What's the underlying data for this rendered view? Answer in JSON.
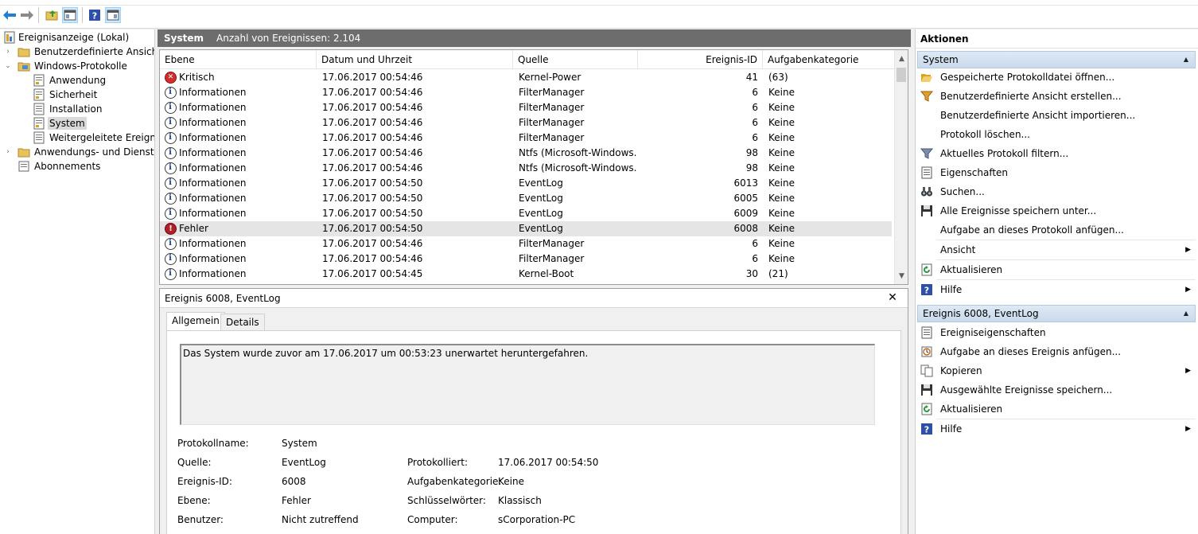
{
  "toolbar": {
    "buttons": [
      "back-icon",
      "forward-icon",
      "up-folder-icon",
      "show-hide-console-tree-icon",
      "help-icon",
      "show-hide-action-pane-icon"
    ]
  },
  "tree": {
    "items": [
      {
        "label": "Ereignisanzeige (Lokal)",
        "icon": "event-viewer-icon"
      },
      {
        "label": "Benutzerdefinierte Ansichten",
        "icon": "folder-icon"
      },
      {
        "label": "Windows-Protokolle",
        "icon": "folder-icon"
      },
      {
        "label": "Anwendung",
        "icon": "log-icon"
      },
      {
        "label": "Sicherheit",
        "icon": "log-icon"
      },
      {
        "label": "Installation",
        "icon": "log-icon"
      },
      {
        "label": "System",
        "icon": "log-icon"
      },
      {
        "label": "Weitergeleitete Ereignisse",
        "icon": "log-icon"
      },
      {
        "label": "Anwendungs- und Dienstprotokolle",
        "icon": "folder-icon"
      },
      {
        "label": "Abonnements",
        "icon": "subscriptions-icon"
      }
    ]
  },
  "center": {
    "title": "System",
    "count_text": "Anzahl von Ereignissen: 2.104"
  },
  "columns": {
    "level": "Ebene",
    "date": "Datum und Uhrzeit",
    "source": "Quelle",
    "id": "Ereignis-ID",
    "category": "Aufgabenkategorie"
  },
  "events": [
    {
      "level": "Kritisch",
      "kind": "crit",
      "date": "17.06.2017 00:54:46",
      "source": "Kernel-Power",
      "id": "41",
      "category": "(63)"
    },
    {
      "level": "Informationen",
      "kind": "info",
      "date": "17.06.2017 00:54:46",
      "source": "FilterManager",
      "id": "6",
      "category": "Keine"
    },
    {
      "level": "Informationen",
      "kind": "info",
      "date": "17.06.2017 00:54:46",
      "source": "FilterManager",
      "id": "6",
      "category": "Keine"
    },
    {
      "level": "Informationen",
      "kind": "info",
      "date": "17.06.2017 00:54:46",
      "source": "FilterManager",
      "id": "6",
      "category": "Keine"
    },
    {
      "level": "Informationen",
      "kind": "info",
      "date": "17.06.2017 00:54:46",
      "source": "FilterManager",
      "id": "6",
      "category": "Keine"
    },
    {
      "level": "Informationen",
      "kind": "info",
      "date": "17.06.2017 00:54:46",
      "source": "Ntfs (Microsoft-Windows...",
      "id": "98",
      "category": "Keine"
    },
    {
      "level": "Informationen",
      "kind": "info",
      "date": "17.06.2017 00:54:46",
      "source": "Ntfs (Microsoft-Windows...",
      "id": "98",
      "category": "Keine"
    },
    {
      "level": "Informationen",
      "kind": "info",
      "date": "17.06.2017 00:54:50",
      "source": "EventLog",
      "id": "6013",
      "category": "Keine"
    },
    {
      "level": "Informationen",
      "kind": "info",
      "date": "17.06.2017 00:54:50",
      "source": "EventLog",
      "id": "6005",
      "category": "Keine"
    },
    {
      "level": "Informationen",
      "kind": "info",
      "date": "17.06.2017 00:54:50",
      "source": "EventLog",
      "id": "6009",
      "category": "Keine"
    },
    {
      "level": "Fehler",
      "kind": "err",
      "date": "17.06.2017 00:54:50",
      "source": "EventLog",
      "id": "6008",
      "category": "Keine",
      "selected": true
    },
    {
      "level": "Informationen",
      "kind": "info",
      "date": "17.06.2017 00:54:46",
      "source": "FilterManager",
      "id": "6",
      "category": "Keine"
    },
    {
      "level": "Informationen",
      "kind": "info",
      "date": "17.06.2017 00:54:46",
      "source": "FilterManager",
      "id": "6",
      "category": "Keine"
    },
    {
      "level": "Informationen",
      "kind": "info",
      "date": "17.06.2017 00:54:45",
      "source": "Kernel-Boot",
      "id": "30",
      "category": "(21)"
    }
  ],
  "detail": {
    "title": "Ereignis 6008, EventLog",
    "tabs": [
      "Allgemein",
      "Details"
    ],
    "message": "Das System wurde zuvor am 17.06.2017 um 00:53:23 unerwartet heruntergefahren.",
    "labels": {
      "logname": "Protokollname:",
      "source": "Quelle:",
      "eventid": "Ereignis-ID:",
      "level": "Ebene:",
      "user": "Benutzer:",
      "logged": "Protokolliert:",
      "taskcat": "Aufgabenkategorie:",
      "keywords": "Schlüsselwörter:",
      "computer": "Computer:"
    },
    "values": {
      "logname": "System",
      "source": "EventLog",
      "eventid": "6008",
      "level": "Fehler",
      "user": "Nicht zutreffend",
      "logged": "17.06.2017 00:54:50",
      "taskcat": "Keine",
      "keywords": "Klassisch",
      "computer": "sCorporation-PC"
    }
  },
  "actions": {
    "title": "Aktionen",
    "section1": "System",
    "items1": [
      {
        "label": "Gespeicherte Protokolldatei öffnen...",
        "icon": "open-folder-icon"
      },
      {
        "label": "Benutzerdefinierte Ansicht erstellen...",
        "icon": "filter-create-icon"
      },
      {
        "label": "Benutzerdefinierte Ansicht importieren...",
        "icon": ""
      },
      {
        "label": "Protokoll löschen...",
        "icon": ""
      },
      {
        "label": "Aktuelles Protokoll filtern...",
        "icon": "filter-icon"
      },
      {
        "label": "Eigenschaften",
        "icon": "properties-icon"
      },
      {
        "label": "Suchen...",
        "icon": "binoculars-icon"
      },
      {
        "label": "Alle Ereignisse speichern unter...",
        "icon": "save-icon"
      },
      {
        "label": "Aufgabe an dieses Protokoll anfügen...",
        "icon": ""
      },
      {
        "label": "Ansicht",
        "icon": "",
        "submenu": true
      },
      {
        "label": "Aktualisieren",
        "icon": "refresh-icon"
      },
      {
        "label": "Hilfe",
        "icon": "help-icon",
        "submenu": true
      }
    ],
    "section2": "Ereignis 6008, EventLog",
    "items2": [
      {
        "label": "Ereigniseigenschaften",
        "icon": "properties-icon"
      },
      {
        "label": "Aufgabe an dieses Ereignis anfügen...",
        "icon": "task-icon"
      },
      {
        "label": "Kopieren",
        "icon": "copy-icon",
        "submenu": true
      },
      {
        "label": "Ausgewählte Ereignisse speichern...",
        "icon": "save-icon"
      },
      {
        "label": "Aktualisieren",
        "icon": "refresh-icon"
      },
      {
        "label": "Hilfe",
        "icon": "help-icon",
        "submenu": true
      }
    ]
  },
  "colors": {
    "header_bar": "#6d6d6d",
    "section_bar": "#c9d9ec",
    "selected_row": "#e5e5e5"
  }
}
